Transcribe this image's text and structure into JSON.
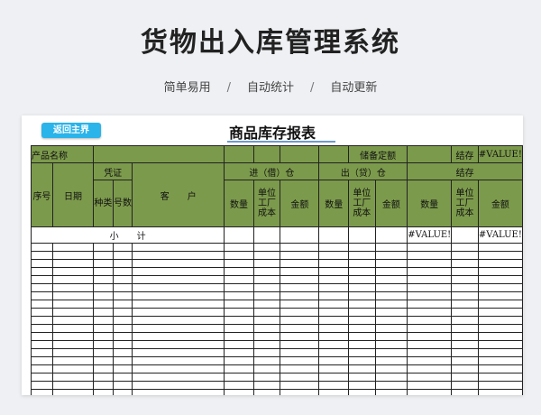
{
  "header": {
    "title": "货物出入库管理系统",
    "features": [
      "简单易用",
      "自动统计",
      "自动更新"
    ],
    "separator": "/"
  },
  "sheet": {
    "back_button": "返回主界",
    "report_title": "商品库存报表",
    "row1": {
      "product_name": "产品名称",
      "safety_stock": "储备定额",
      "balance": "结存",
      "balance_value": "#VALUE!"
    },
    "headers": {
      "seq": "序号",
      "date": "日期",
      "voucher": "凭证",
      "voucher_type": "种类",
      "voucher_no": "号数",
      "customer": "客　　户",
      "in_group": "进（借）仓",
      "out_group": "出（贷）仓",
      "balance_group": "结存",
      "qty": "数量",
      "unit_cost": "单位工厂成本",
      "amount": "金额"
    },
    "subtotal": {
      "label": "小　　计",
      "balance_qty": "#VALUE!",
      "balance_amount": "#VALUE!"
    }
  },
  "colors": {
    "header_fill": "#7c9a4c",
    "button": "#2ab4ea",
    "title_underline": "#6f9bc7"
  }
}
